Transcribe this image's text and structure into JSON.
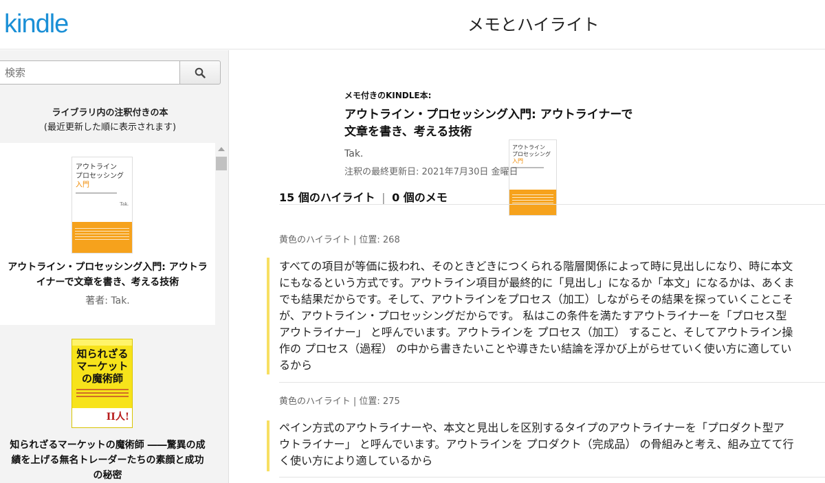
{
  "header": {
    "logo": "kindle",
    "title": "メモとハイライト"
  },
  "sidebar": {
    "search_placeholder": "検索",
    "heading": "ライブラリ内の注釈付きの本",
    "subheading": "(最近更新した順に表示されます)",
    "books": [
      {
        "title": "アウトライン・プロセッシング入門: アウトライナーで文章を書き、考える技術",
        "author": "著者: Tak.",
        "cover": {
          "line1": "アウトライン",
          "line2": "プロセッシング",
          "line3": "入門",
          "author": "Tak.",
          "accent": "#f6a21c"
        }
      },
      {
        "title": "知られざるマーケットの魔術師 ――驚異の成績を上げる無名トレーダーたちの素顔と成功の秘密",
        "cover": {
          "title": "知られざるマーケットの魔術師",
          "badge": "II人!",
          "accent": "#f7e31b"
        }
      }
    ]
  },
  "main": {
    "meta_label": "メモ付きのKINDLE本:",
    "title": "アウトライン・プロセッシング入門: アウトライナーで文章を書き、考える技術",
    "author": "Tak.",
    "updated": "注釈の最終更新日:  2021年7月30日 金曜日",
    "highlights_count": "15 個のハイライト",
    "separator": "|",
    "notes_count": "0 個のメモ",
    "highlights": [
      {
        "header": "黄色のハイライト | 位置: 268",
        "text": "すべての項目が等価に扱われ、そのときどきにつくられる階層関係によって時に見出しになり、時に本文にもなるという方式です。アウトライン項目が最終的に「見出し」になるか「本文」になるかは、あくまでも結果だからです。そして、アウトラインをプロセス（加工）しながらその結果を探っていくことこそが、アウトライン・プロセッシングだからです。 私はこの条件を満たすアウトライナーを「プロセス型アウトライナー」 と呼んでいます。アウトラインを プロセス（加工） すること、そしてアウトライン操作の プロセス（過程） の中から書きたいことや導きたい結論を浮かび上がらせていく使い方に適しているから"
      },
      {
        "header": "黄色のハイライト | 位置: 275",
        "text": "ペイン方式のアウトライナーや、本文と見出しを区別するタイプのアウトライナーを「プロダクト型アウトライナー」 と呼んでいます。アウトラインを プロダクト（完成品） の骨組みと考え、組み立てて行く使い方により適しているから"
      }
    ]
  },
  "colors": {
    "brand": "#1a8fd6",
    "highlight_bar": "#f7df62"
  },
  "icons": [
    "search-icon",
    "scroll-up-arrow-icon"
  ]
}
